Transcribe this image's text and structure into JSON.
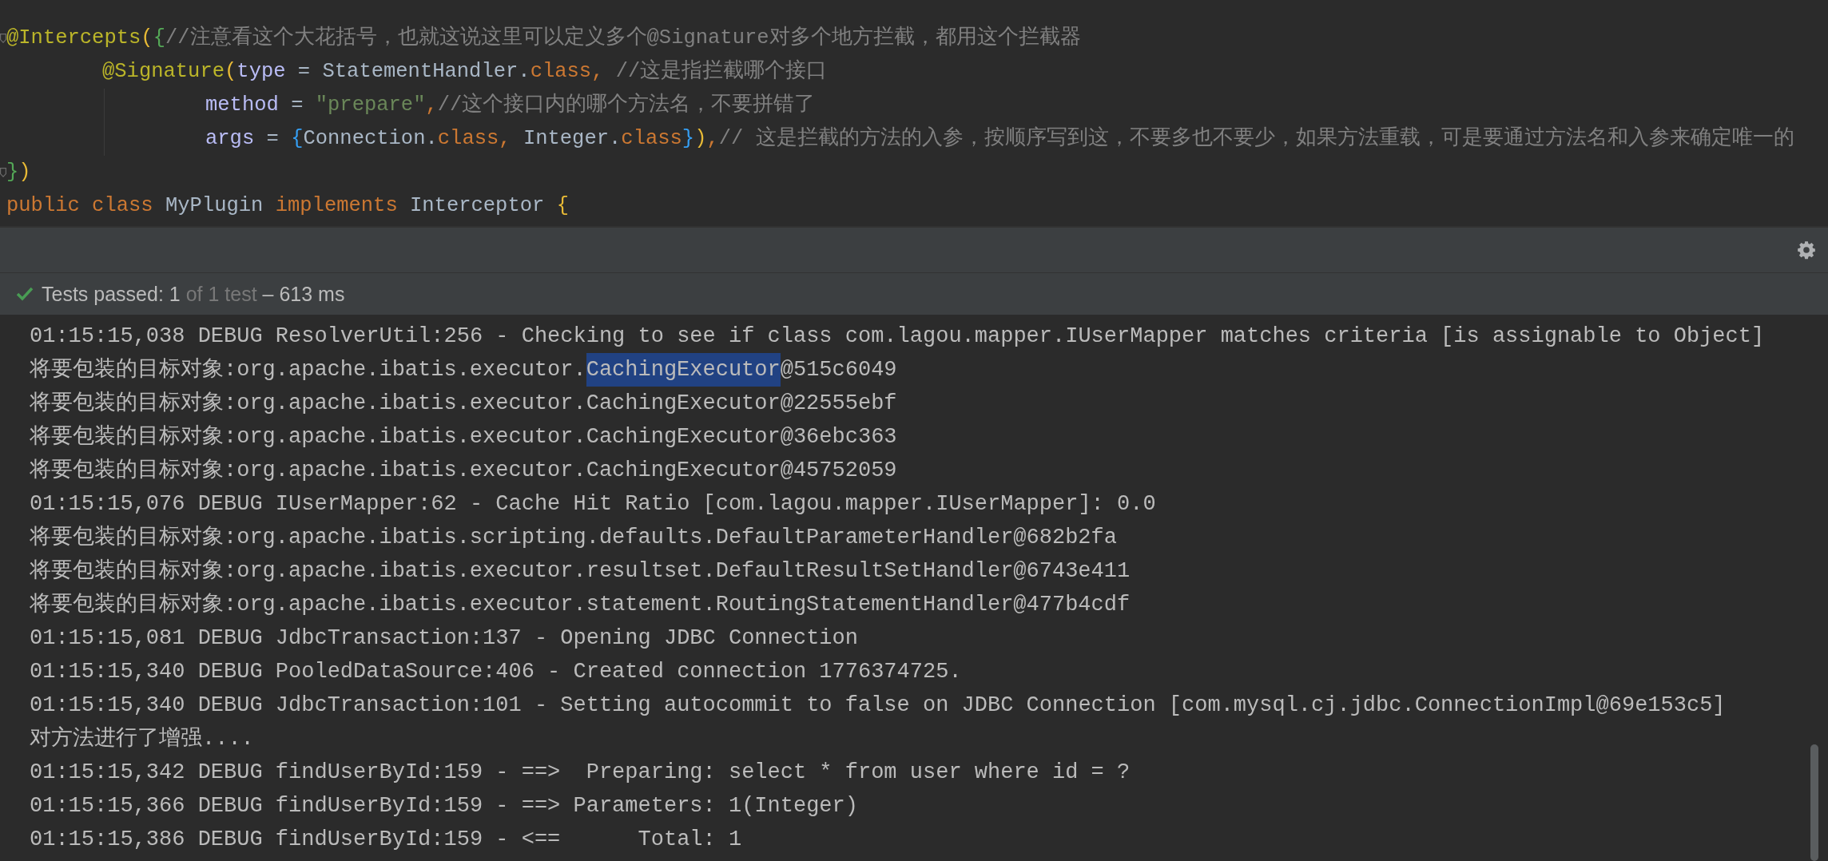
{
  "editor": {
    "lines": [
      {
        "fold": true,
        "tokens": [
          {
            "kind": "annotation",
            "text": "@Intercepts"
          },
          {
            "kind": "paren",
            "text": "("
          },
          {
            "kind": "brace",
            "text": "{"
          },
          {
            "kind": "comment",
            "text": "//注意看这个大花括号，也就这说这里可以定义多个@Signature对多个地方拦截，都用这个拦截器"
          }
        ],
        "children": [
          {
            "tokens": [
              {
                "kind": "annotation",
                "text": "@Signature"
              },
              {
                "kind": "paren",
                "text": "("
              },
              {
                "kind": "field",
                "text": "type"
              },
              {
                "kind": "plain",
                "text": " = StatementHandler."
              },
              {
                "kind": "keyword",
                "text": "class, "
              },
              {
                "kind": "comment",
                "text": "//这是指拦截哪个接口"
              }
            ],
            "children": [
              {
                "tokens": [
                  {
                    "kind": "field",
                    "text": "method"
                  },
                  {
                    "kind": "plain",
                    "text": " = "
                  },
                  {
                    "kind": "string",
                    "text": "\"prepare\""
                  },
                  {
                    "kind": "keyword",
                    "text": ","
                  },
                  {
                    "kind": "comment",
                    "text": "//这个接口内的哪个方法名，不要拼错了"
                  }
                ]
              },
              {
                "tokens": [
                  {
                    "kind": "field",
                    "text": "args"
                  },
                  {
                    "kind": "plain",
                    "text": " = "
                  },
                  {
                    "kind": "array",
                    "text": "{"
                  },
                  {
                    "kind": "plain",
                    "text": "Connection."
                  },
                  {
                    "kind": "keyword",
                    "text": "class, "
                  },
                  {
                    "kind": "plain",
                    "text": "Integer."
                  },
                  {
                    "kind": "keyword",
                    "text": "class"
                  },
                  {
                    "kind": "array",
                    "text": "}"
                  },
                  {
                    "kind": "paren",
                    "text": ")"
                  },
                  {
                    "kind": "keyword",
                    "text": ","
                  },
                  {
                    "kind": "comment",
                    "text": "// 这是拦截的方法的入参，按顺序写到这，不要多也不要少，如果方法重载，可是要通过方法名和入参来确定唯一的"
                  }
                ]
              }
            ]
          }
        ]
      },
      {
        "fold": true,
        "tokens": [
          {
            "kind": "brace",
            "text": "}"
          },
          {
            "kind": "paren",
            "text": ")"
          }
        ]
      },
      {
        "fold": false,
        "tokens": [
          {
            "kind": "keyword",
            "text": "public class "
          },
          {
            "kind": "plain",
            "text": "MyPlugin "
          },
          {
            "kind": "keyword",
            "text": "implements "
          },
          {
            "kind": "plain",
            "text": "Interceptor "
          },
          {
            "kind": "paren",
            "text": "{"
          }
        ]
      }
    ]
  },
  "test_status": {
    "passed": true,
    "summary": "Tests passed: 1",
    "detail": "of 1 test",
    "duration": "– 613 ms"
  },
  "console": {
    "lines": [
      {
        "parts": [
          {
            "text": "01:15:15,038 DEBUG ResolverUtil:256 - Checking to see if class com.lagou.mapper.IUserMapper matches criteria [is assignable to Object]",
            "selected": false
          }
        ]
      },
      {
        "parts": [
          {
            "text": "将要包装的目标对象:org.apache.ibatis.executor.",
            "selected": false
          },
          {
            "text": "CachingExecutor",
            "selected": true
          },
          {
            "text": "@515c6049",
            "selected": false
          }
        ]
      },
      {
        "parts": [
          {
            "text": "将要包装的目标对象:org.apache.ibatis.executor.CachingExecutor@22555ebf",
            "selected": false
          }
        ]
      },
      {
        "parts": [
          {
            "text": "将要包装的目标对象:org.apache.ibatis.executor.CachingExecutor@36ebc363",
            "selected": false
          }
        ]
      },
      {
        "parts": [
          {
            "text": "将要包装的目标对象:org.apache.ibatis.executor.CachingExecutor@45752059",
            "selected": false
          }
        ]
      },
      {
        "parts": [
          {
            "text": "01:15:15,076 DEBUG IUserMapper:62 - Cache Hit Ratio [com.lagou.mapper.IUserMapper]: 0.0",
            "selected": false
          }
        ]
      },
      {
        "parts": [
          {
            "text": "将要包装的目标对象:org.apache.ibatis.scripting.defaults.DefaultParameterHandler@682b2fa",
            "selected": false
          }
        ]
      },
      {
        "parts": [
          {
            "text": "将要包装的目标对象:org.apache.ibatis.executor.resultset.DefaultResultSetHandler@6743e411",
            "selected": false
          }
        ]
      },
      {
        "parts": [
          {
            "text": "将要包装的目标对象:org.apache.ibatis.executor.statement.RoutingStatementHandler@477b4cdf",
            "selected": false
          }
        ]
      },
      {
        "parts": [
          {
            "text": "01:15:15,081 DEBUG JdbcTransaction:137 - Opening JDBC Connection",
            "selected": false
          }
        ]
      },
      {
        "parts": [
          {
            "text": "01:15:15,340 DEBUG PooledDataSource:406 - Created connection 1776374725.",
            "selected": false
          }
        ]
      },
      {
        "parts": [
          {
            "text": "01:15:15,340 DEBUG JdbcTransaction:101 - Setting autocommit to false on JDBC Connection [com.mysql.cj.jdbc.ConnectionImpl@69e153c5]",
            "selected": false
          }
        ]
      },
      {
        "parts": [
          {
            "text": "对方法进行了增强....",
            "selected": false
          }
        ]
      },
      {
        "parts": [
          {
            "text": "01:15:15,342 DEBUG findUserById:159 - ==>  Preparing: select * from user where id = ?",
            "selected": false
          }
        ]
      },
      {
        "parts": [
          {
            "text": "01:15:15,366 DEBUG findUserById:159 - ==> Parameters: 1(Integer)",
            "selected": false
          }
        ]
      },
      {
        "parts": [
          {
            "text": "01:15:15,386 DEBUG findUserById:159 - <==      Total: 1",
            "selected": false
          }
        ]
      }
    ]
  }
}
